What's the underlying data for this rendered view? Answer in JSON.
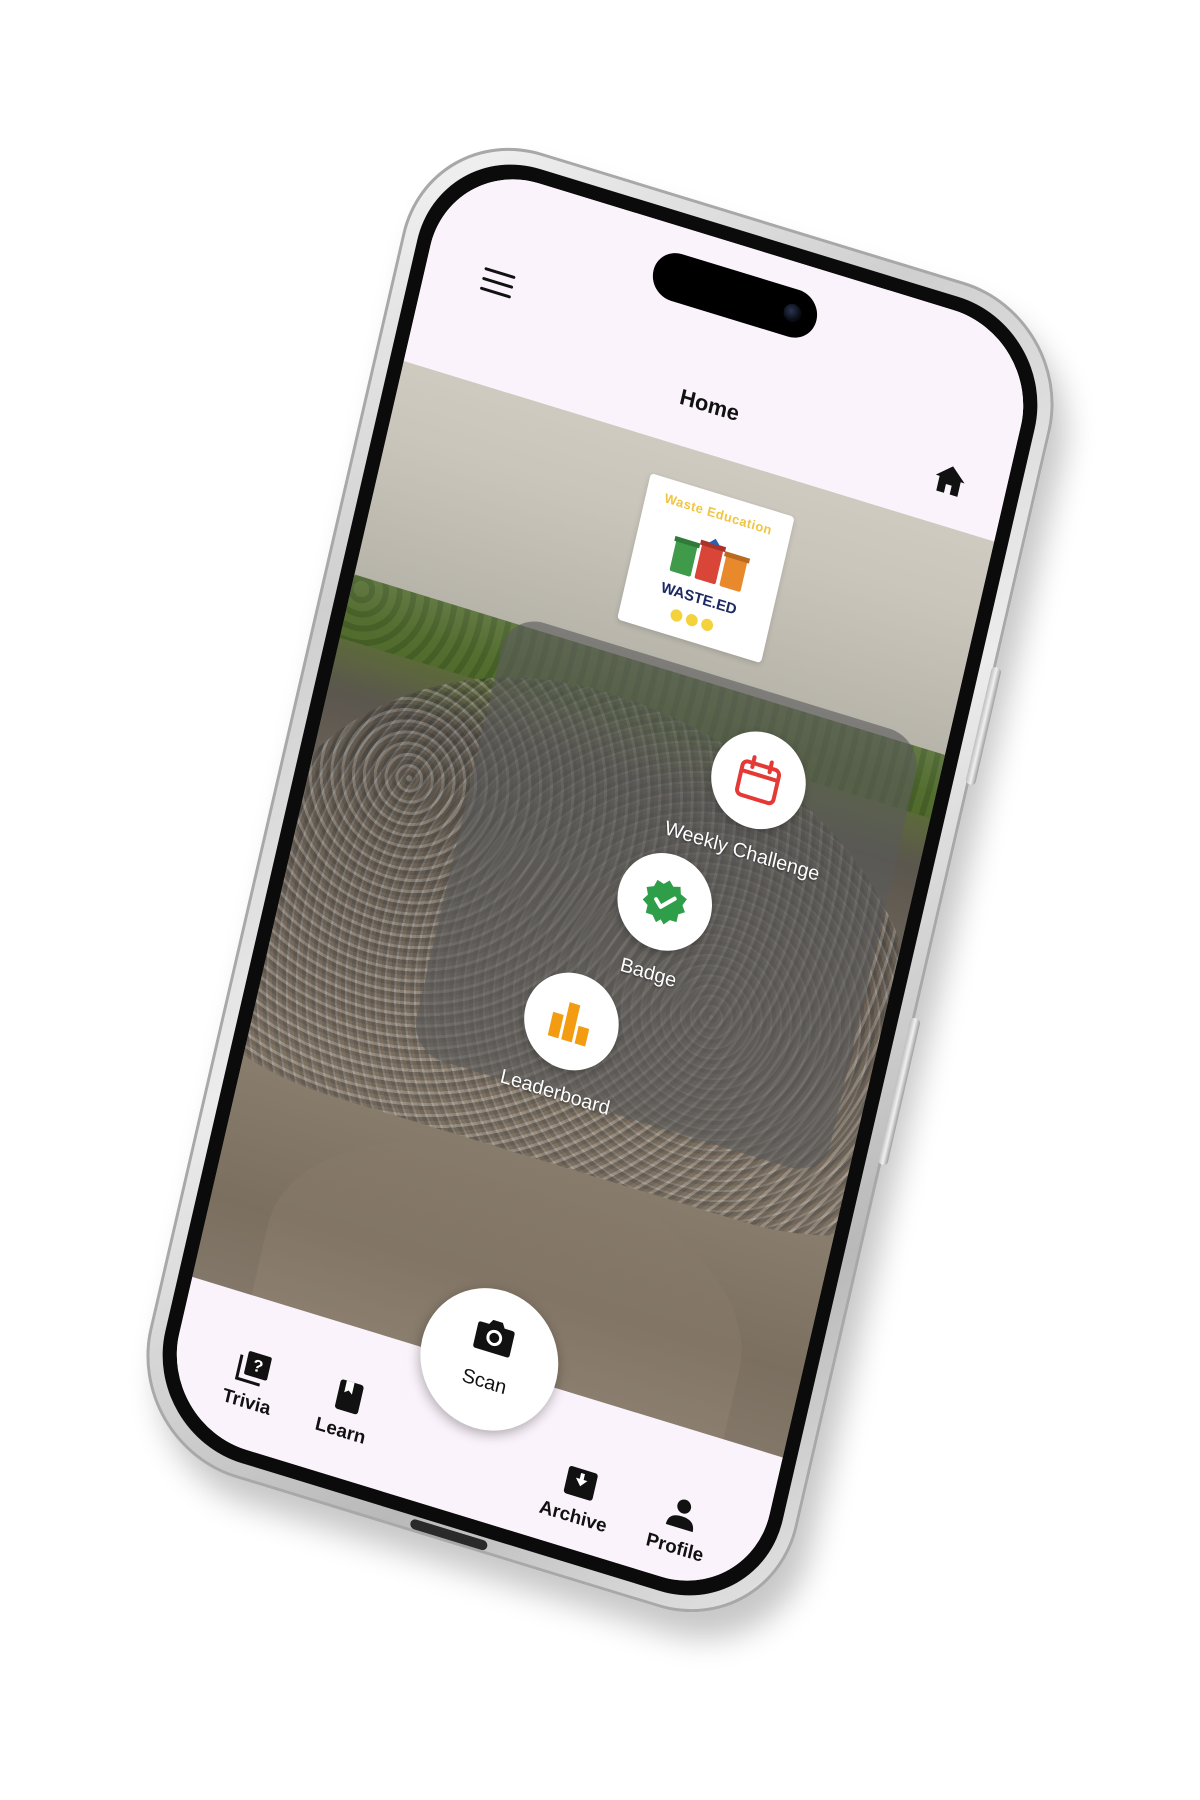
{
  "header": {
    "title": "Home",
    "menu_icon": "hamburger-menu-icon",
    "home_icon": "home-icon"
  },
  "logo": {
    "arc_text": "Waste Education",
    "name": "WASTE.ED"
  },
  "menu": {
    "items": [
      {
        "label": "Weekly Challenge",
        "icon": "calendar-icon",
        "color": "#e53935"
      },
      {
        "label": "Badge",
        "icon": "verified-badge-icon",
        "color": "#2e9e48"
      },
      {
        "label": "Leaderboard",
        "icon": "bar-chart-icon",
        "color": "#f39c12"
      }
    ]
  },
  "bottom_nav": {
    "items": [
      {
        "label": "Trivia",
        "icon": "quiz-icon"
      },
      {
        "label": "Learn",
        "icon": "book-icon"
      },
      {
        "label": "Archive",
        "icon": "archive-icon"
      },
      {
        "label": "Profile",
        "icon": "person-icon"
      }
    ],
    "scan": {
      "label": "Scan",
      "icon": "camera-icon"
    }
  },
  "colors": {
    "header_bg": "#fbf3fb",
    "panel_bg": "rgba(90,90,90,0.62)",
    "logo_name": "#1c2a63",
    "logo_accent": "#f0c541"
  }
}
